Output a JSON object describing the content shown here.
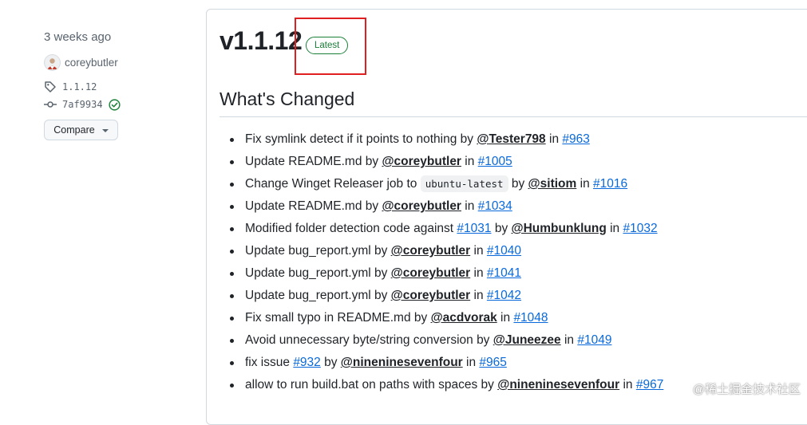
{
  "sidebar": {
    "date": "3 weeks ago",
    "author": "coreybutler",
    "tag": "1.1.12",
    "commit": "7af9934",
    "compare_label": "Compare"
  },
  "release": {
    "version": "v1.1.12",
    "badge": "Latest",
    "section_title": "What's Changed"
  },
  "changes": [
    [
      {
        "t": "text",
        "v": "Fix symlink detect if it points to nothing by "
      },
      {
        "t": "user",
        "v": "@Tester798"
      },
      {
        "t": "text",
        "v": " in "
      },
      {
        "t": "link",
        "v": "#963"
      }
    ],
    [
      {
        "t": "text",
        "v": "Update README.md by "
      },
      {
        "t": "user",
        "v": "@coreybutler"
      },
      {
        "t": "text",
        "v": " in "
      },
      {
        "t": "link",
        "v": "#1005"
      }
    ],
    [
      {
        "t": "text",
        "v": "Change Winget Releaser job to "
      },
      {
        "t": "code",
        "v": "ubuntu-latest"
      },
      {
        "t": "text",
        "v": " by "
      },
      {
        "t": "user",
        "v": "@sitiom"
      },
      {
        "t": "text",
        "v": " in "
      },
      {
        "t": "link",
        "v": "#1016"
      }
    ],
    [
      {
        "t": "text",
        "v": "Update README.md by "
      },
      {
        "t": "user",
        "v": "@coreybutler"
      },
      {
        "t": "text",
        "v": " in "
      },
      {
        "t": "link",
        "v": "#1034"
      }
    ],
    [
      {
        "t": "text",
        "v": "Modified folder detection code against "
      },
      {
        "t": "link",
        "v": "#1031"
      },
      {
        "t": "text",
        "v": " by "
      },
      {
        "t": "user",
        "v": "@Humbunklung"
      },
      {
        "t": "text",
        "v": " in "
      },
      {
        "t": "link",
        "v": "#1032"
      }
    ],
    [
      {
        "t": "text",
        "v": "Update bug_report.yml by "
      },
      {
        "t": "user",
        "v": "@coreybutler"
      },
      {
        "t": "text",
        "v": " in "
      },
      {
        "t": "link",
        "v": "#1040"
      }
    ],
    [
      {
        "t": "text",
        "v": "Update bug_report.yml by "
      },
      {
        "t": "user",
        "v": "@coreybutler"
      },
      {
        "t": "text",
        "v": " in "
      },
      {
        "t": "link",
        "v": "#1041"
      }
    ],
    [
      {
        "t": "text",
        "v": "Update bug_report.yml by "
      },
      {
        "t": "user",
        "v": "@coreybutler"
      },
      {
        "t": "text",
        "v": " in "
      },
      {
        "t": "link",
        "v": "#1042"
      }
    ],
    [
      {
        "t": "text",
        "v": "Fix small typo in README.md by "
      },
      {
        "t": "user",
        "v": "@acdvorak"
      },
      {
        "t": "text",
        "v": " in "
      },
      {
        "t": "link",
        "v": "#1048"
      }
    ],
    [
      {
        "t": "text",
        "v": "Avoid unnecessary byte/string conversion by "
      },
      {
        "t": "user",
        "v": "@Juneezee"
      },
      {
        "t": "text",
        "v": " in "
      },
      {
        "t": "link",
        "v": "#1049"
      }
    ],
    [
      {
        "t": "text",
        "v": "fix issue "
      },
      {
        "t": "link",
        "v": "#932"
      },
      {
        "t": "text",
        "v": " by "
      },
      {
        "t": "user",
        "v": "@nineninesevenfour"
      },
      {
        "t": "text",
        "v": " in "
      },
      {
        "t": "link",
        "v": "#965"
      }
    ],
    [
      {
        "t": "text",
        "v": "allow to run build.bat on paths with spaces by "
      },
      {
        "t": "user",
        "v": "@nineninesevenfour"
      },
      {
        "t": "text",
        "v": " in "
      },
      {
        "t": "link",
        "v": "#967"
      }
    ]
  ],
  "watermark": "@稀土掘金技术社区",
  "colors": {
    "link": "#0969da",
    "badge_green": "#1a7f37",
    "highlight_red": "#e02020",
    "verified_green": "#1a7f37"
  },
  "icons": [
    "avatar",
    "tag-icon",
    "git-commit-icon",
    "verified-check-icon",
    "caret-down-icon"
  ]
}
